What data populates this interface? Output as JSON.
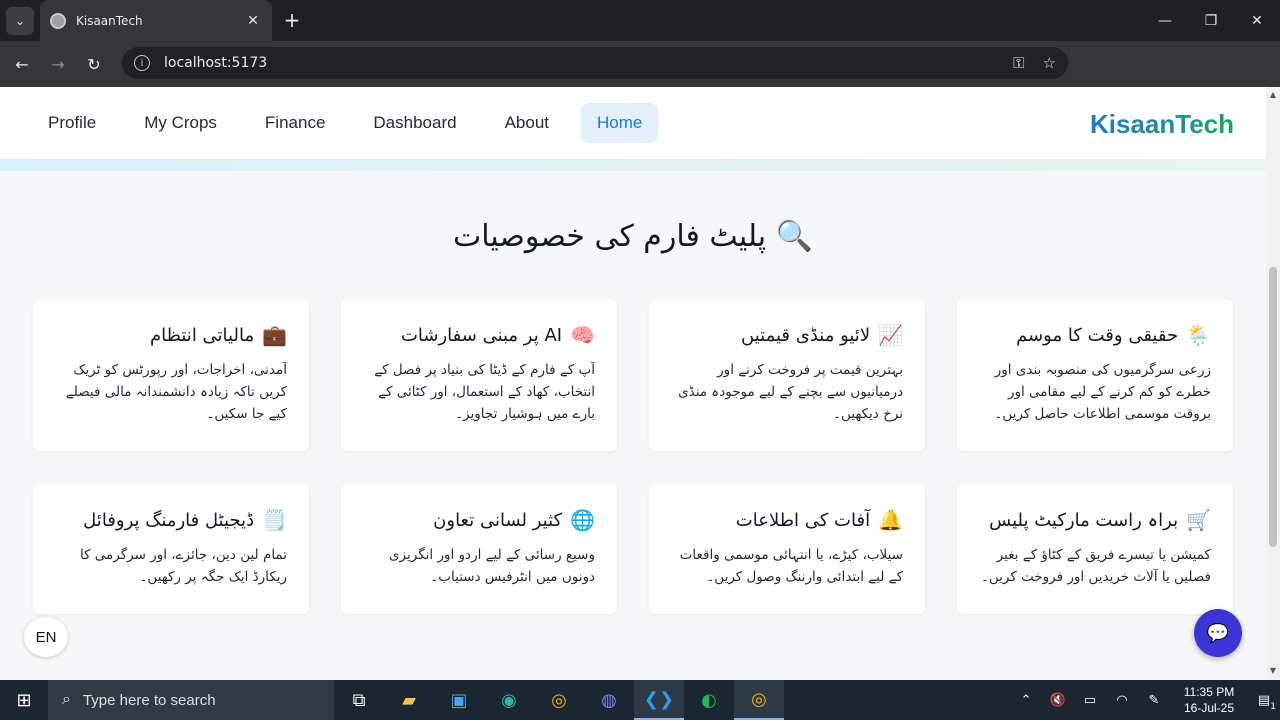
{
  "browser": {
    "tab_title": "KisaanTech",
    "url": "localhost:5173"
  },
  "nav": {
    "links": [
      "Profile",
      "My Crops",
      "Finance",
      "Dashboard",
      "About",
      "Home"
    ],
    "brand": "KisaanTech"
  },
  "section": {
    "title": "🔍 پلیٹ فارم کی خصوصیات"
  },
  "cards": [
    {
      "icon": "🌦️",
      "title": "حقیقی وقت کا موسم",
      "body": "زرعی سرگرمیوں کی منصوبہ بندی اور خطرے کو کم کرنے کے لیے مقامی اور بروقت موسمی اطلاعات حاصل کریں۔"
    },
    {
      "icon": "📈",
      "title": "لائیو منڈی قیمتیں",
      "body": "بہترین قیمت پر فروخت کرنے اور درمیانیوں سے بچنے کے لیے موجودہ منڈی نرخ دیکھیں۔"
    },
    {
      "icon": "🧠",
      "title": "AI پر مبنی سفارشات",
      "body": "آپ کے فارم کے ڈیٹا کی بنیاد پر فصل کے انتخاب، کھاد کے استعمال، اور کٹائی کے بارے میں ہوشیار تجاویز۔"
    },
    {
      "icon": "💼",
      "title": "مالیاتی انتظام",
      "body": "آمدنی، اخراجات، اور رپورٹس کو ٹریک کریں تاکہ زیادہ دانشمندانہ مالی فیصلے کیے جا سکیں۔"
    },
    {
      "icon": "🛒",
      "title": "براہ راست مارکیٹ پلیس",
      "body": "کمیشن یا تیسرے فریق کے کٹاؤ کے بغیر فصلیں یا آلات خریدیں اور فروخت کریں۔"
    },
    {
      "icon": "🔔",
      "title": "آفات کی اطلاعات",
      "body": "سیلاب، کیڑے، یا انتہائی موسمی واقعات کے لیے ابتدائی وارننگ وصول کریں۔"
    },
    {
      "icon": "🌐",
      "title": "کثیر لسانی تعاون",
      "body": "وسیع رسائی کے لیے اردو اور انگریزی دونوں میں انٹرفیس دستیاب۔"
    },
    {
      "icon": "🗒️",
      "title": "ڈیجیٹل فارمنگ پروفائل",
      "body": "تمام لین دین، جائزے، اور سرگرمی کا ریکارڈ ایک جگہ پر رکھیں۔"
    }
  ],
  "floating": {
    "lang_label": "EN"
  },
  "taskbar": {
    "search_placeholder": "Type here to search",
    "time": "11:35 PM",
    "date": "16-Jul-25",
    "notification_count": "1"
  }
}
